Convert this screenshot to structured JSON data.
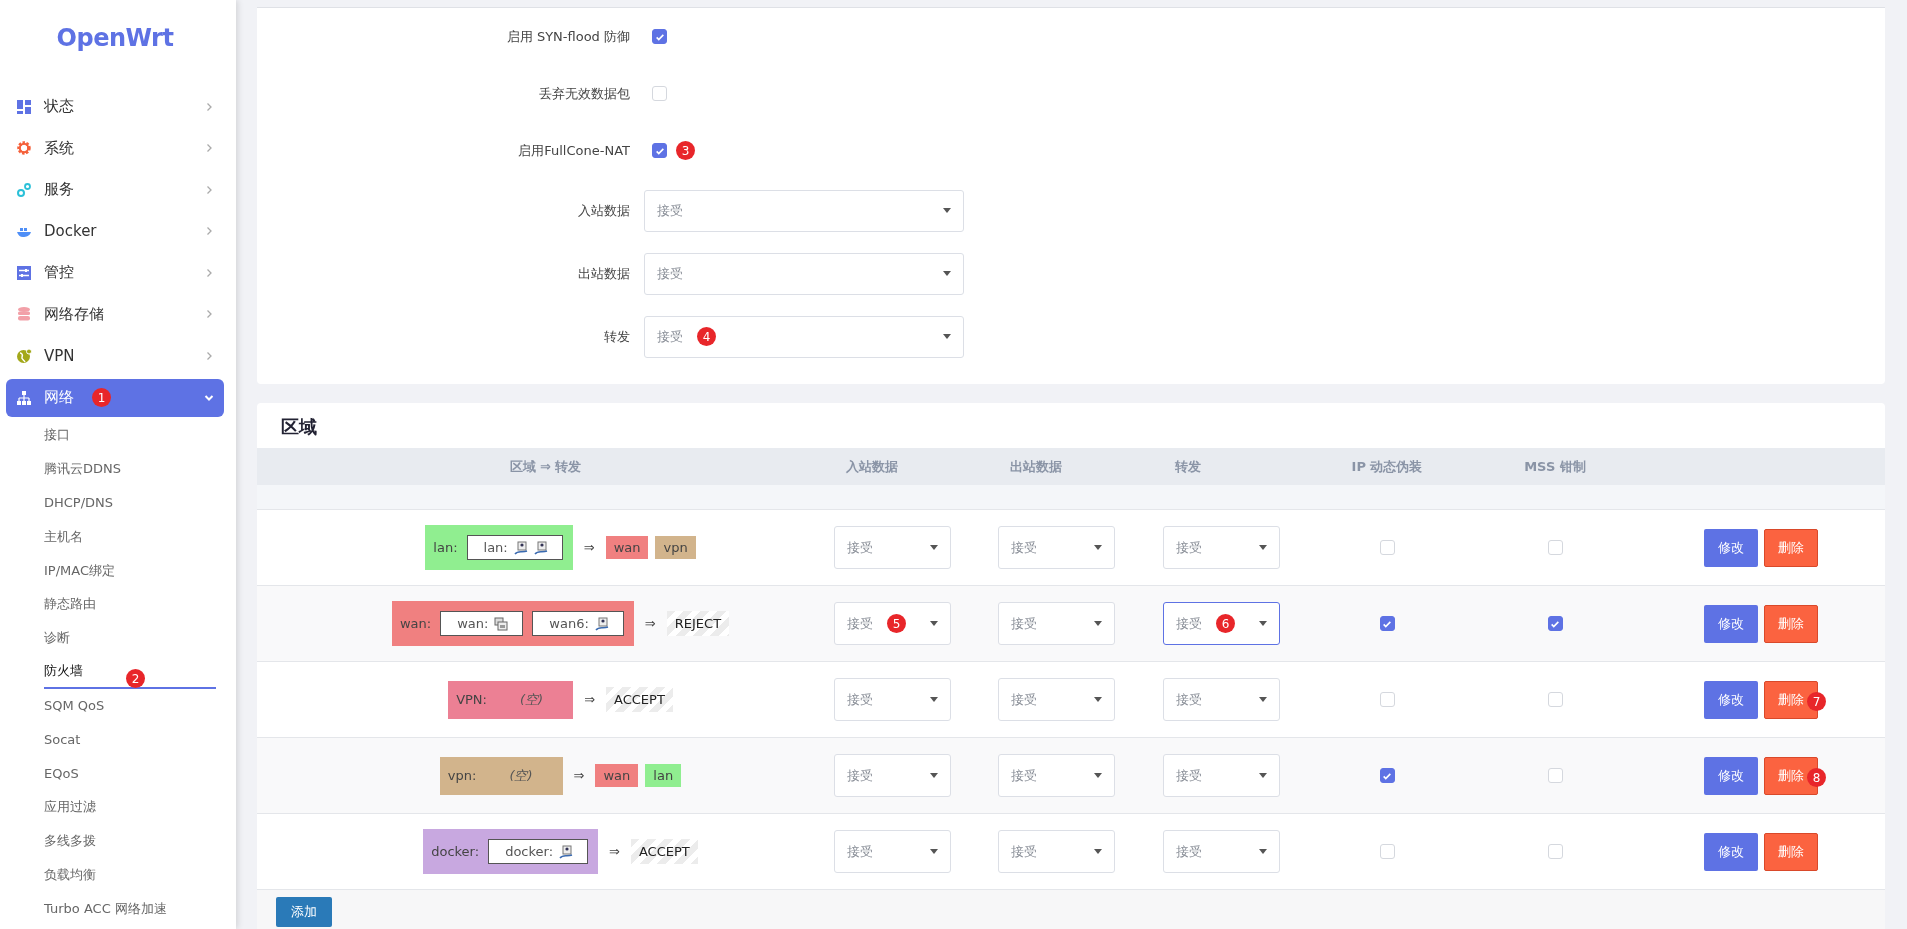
{
  "sidebar": {
    "logo": "OpenWrt",
    "menu": [
      {
        "label": "状态",
        "expanded": false,
        "selected": false
      },
      {
        "label": "系统",
        "expanded": false,
        "selected": false
      },
      {
        "label": "服务",
        "expanded": false,
        "selected": false
      },
      {
        "label": "Docker",
        "expanded": false,
        "selected": false
      },
      {
        "label": "管控",
        "expanded": false,
        "selected": false
      },
      {
        "label": "网络存储",
        "expanded": false,
        "selected": false
      },
      {
        "label": "VPN",
        "expanded": false,
        "selected": false
      },
      {
        "label": "网络",
        "expanded": true,
        "selected": true,
        "badge": "1",
        "children": [
          {
            "label": "接口",
            "selected": false
          },
          {
            "label": "腾讯云DDNS",
            "selected": false
          },
          {
            "label": "DHCP/DNS",
            "selected": false
          },
          {
            "label": "主机名",
            "selected": false
          },
          {
            "label": "IP/MAC绑定",
            "selected": false
          },
          {
            "label": "静态路由",
            "selected": false
          },
          {
            "label": "诊断",
            "selected": false
          },
          {
            "label": "防火墙",
            "selected": true,
            "badge": "2"
          },
          {
            "label": "SQM QoS",
            "selected": false
          },
          {
            "label": "Socat",
            "selected": false
          },
          {
            "label": "EQoS",
            "selected": false
          },
          {
            "label": "应用过滤",
            "selected": false
          },
          {
            "label": "多线多拨",
            "selected": false
          },
          {
            "label": "负载均衡",
            "selected": false
          },
          {
            "label": "Turbo ACC 网络加速",
            "selected": false
          }
        ]
      }
    ]
  },
  "general": {
    "fields": [
      {
        "kind": "checkbox",
        "label": "启用 SYN-flood 防御",
        "checked": true
      },
      {
        "kind": "checkbox",
        "label": "丢弃无效数据包",
        "checked": false
      },
      {
        "kind": "checkbox",
        "label": "启用FullCone-NAT",
        "checked": true,
        "badge": "3"
      },
      {
        "kind": "select",
        "label": "入站数据",
        "value": "接受"
      },
      {
        "kind": "select",
        "label": "出站数据",
        "value": "接受"
      },
      {
        "kind": "select",
        "label": "转发",
        "value": "接受",
        "badge": "4"
      }
    ]
  },
  "zones": {
    "title": "区域",
    "columns": [
      "区域 ⇒ 转发",
      "入站数据",
      "出站数据",
      "转发",
      "IP 动态伪装",
      "MSS 钳制"
    ],
    "rows": [
      {
        "zone": {
          "label": "lan:",
          "color": "#90ee90",
          "networks": [
            {
              "label": "lan:"
            }
          ]
        },
        "targets": [
          {
            "kind": "zone",
            "label": "wan",
            "color": "#f08080"
          },
          {
            "kind": "zone",
            "label": "vpn",
            "color": "#d2b48c"
          }
        ],
        "input": {
          "value": "接受",
          "focused": false
        },
        "output": {
          "value": "接受",
          "focused": false
        },
        "forward": {
          "value": "接受",
          "focused": false
        },
        "masq": false,
        "mss": false,
        "edit": "修改",
        "delete": "删除"
      },
      {
        "zone": {
          "label": "wan:",
          "color": "#f08080",
          "networks": [
            {
              "label": "wan:"
            },
            {
              "label": "wan6:"
            }
          ]
        },
        "targets": [
          {
            "kind": "policy",
            "label": "REJECT"
          }
        ],
        "input": {
          "value": "接受",
          "focused": false,
          "badge": "5"
        },
        "output": {
          "value": "接受",
          "focused": false
        },
        "forward": {
          "value": "接受",
          "focused": true,
          "badge": "6"
        },
        "masq": true,
        "mss": true,
        "edit": "修改",
        "delete": "删除"
      },
      {
        "zone": {
          "label": "VPN:",
          "color": "#ec8094",
          "empty": "(空)"
        },
        "targets": [
          {
            "kind": "policy",
            "label": "ACCEPT"
          }
        ],
        "input": {
          "value": "接受",
          "focused": false
        },
        "output": {
          "value": "接受",
          "focused": false
        },
        "forward": {
          "value": "接受",
          "focused": false
        },
        "masq": false,
        "mss": false,
        "edit": "修改",
        "delete": "删除",
        "delete_badge": "7"
      },
      {
        "zone": {
          "label": "vpn:",
          "color": "#d2b48c",
          "empty": "(空)"
        },
        "targets": [
          {
            "kind": "zone",
            "label": "wan",
            "color": "#f08080"
          },
          {
            "kind": "zone",
            "label": "lan",
            "color": "#90ee90"
          }
        ],
        "input": {
          "value": "接受",
          "focused": false
        },
        "output": {
          "value": "接受",
          "focused": false
        },
        "forward": {
          "value": "接受",
          "focused": false
        },
        "masq": true,
        "mss": false,
        "edit": "修改",
        "delete": "删除",
        "delete_badge": "8"
      },
      {
        "zone": {
          "label": "docker:",
          "color": "#c8a8e0",
          "networks": [
            {
              "label": "docker:"
            }
          ]
        },
        "targets": [
          {
            "kind": "policy",
            "label": "ACCEPT"
          }
        ],
        "input": {
          "value": "接受",
          "focused": false
        },
        "output": {
          "value": "接受",
          "focused": false
        },
        "forward": {
          "value": "接受",
          "focused": false
        },
        "masq": false,
        "mss": false,
        "edit": "修改",
        "delete": "删除"
      }
    ],
    "add_button": "添加",
    "arrow": "⇒"
  }
}
